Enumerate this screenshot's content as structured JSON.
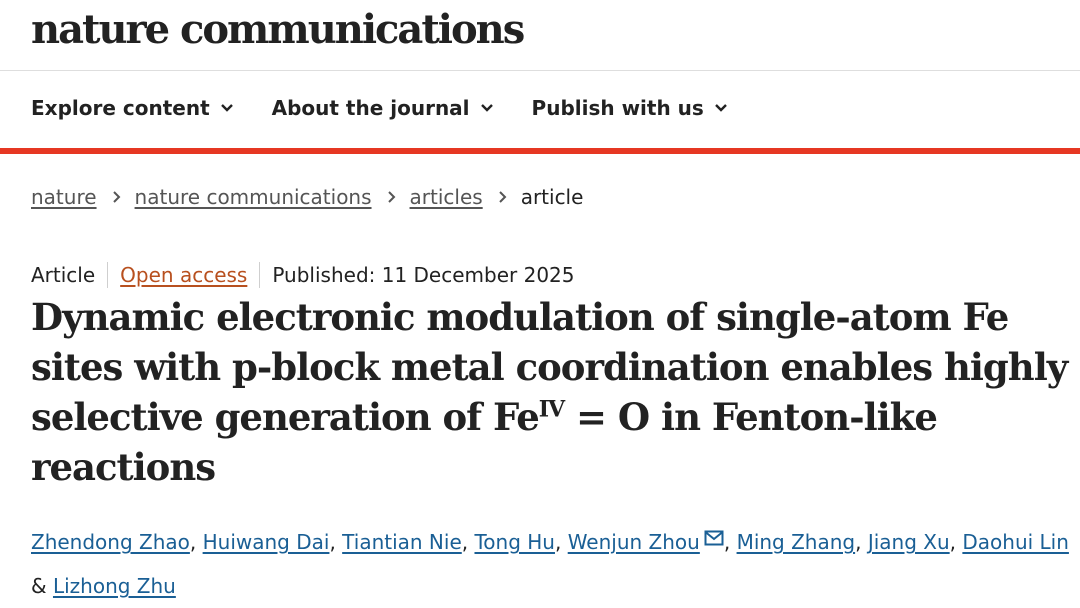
{
  "header": {
    "logo": "nature communications"
  },
  "nav": {
    "items": [
      {
        "label": "Explore content",
        "icon": "chevron-down-icon"
      },
      {
        "label": "About the journal",
        "icon": "chevron-down-icon"
      },
      {
        "label": "Publish with us",
        "icon": "chevron-down-icon"
      }
    ]
  },
  "colors": {
    "accent_bar": "#e63723",
    "open_access": "#b8501f",
    "author_link": "#1a5f95"
  },
  "breadcrumb": {
    "items": [
      "nature",
      "nature communications",
      "articles"
    ],
    "current": "article"
  },
  "article": {
    "type": "Article",
    "access": "Open access",
    "published": "Published: 11 December 2025",
    "title_part1": "Dynamic electronic modulation of single-atom Fe sites with p-block metal coordination enables highly selective generation of Fe",
    "title_sup": "IV",
    "title_part2": " = O in Fenton-like reactions"
  },
  "authors": {
    "list": [
      "Zhendong Zhao",
      "Huiwang Dai",
      "Tiantian Nie",
      "Tong Hu",
      "Wenjun Zhou",
      "Ming Zhang",
      "Jiang Xu",
      "Daohui Lin",
      "Lizhong Zhu"
    ],
    "separator": ",",
    "conjunction": "&",
    "corresponding_icon": "mail-icon"
  }
}
